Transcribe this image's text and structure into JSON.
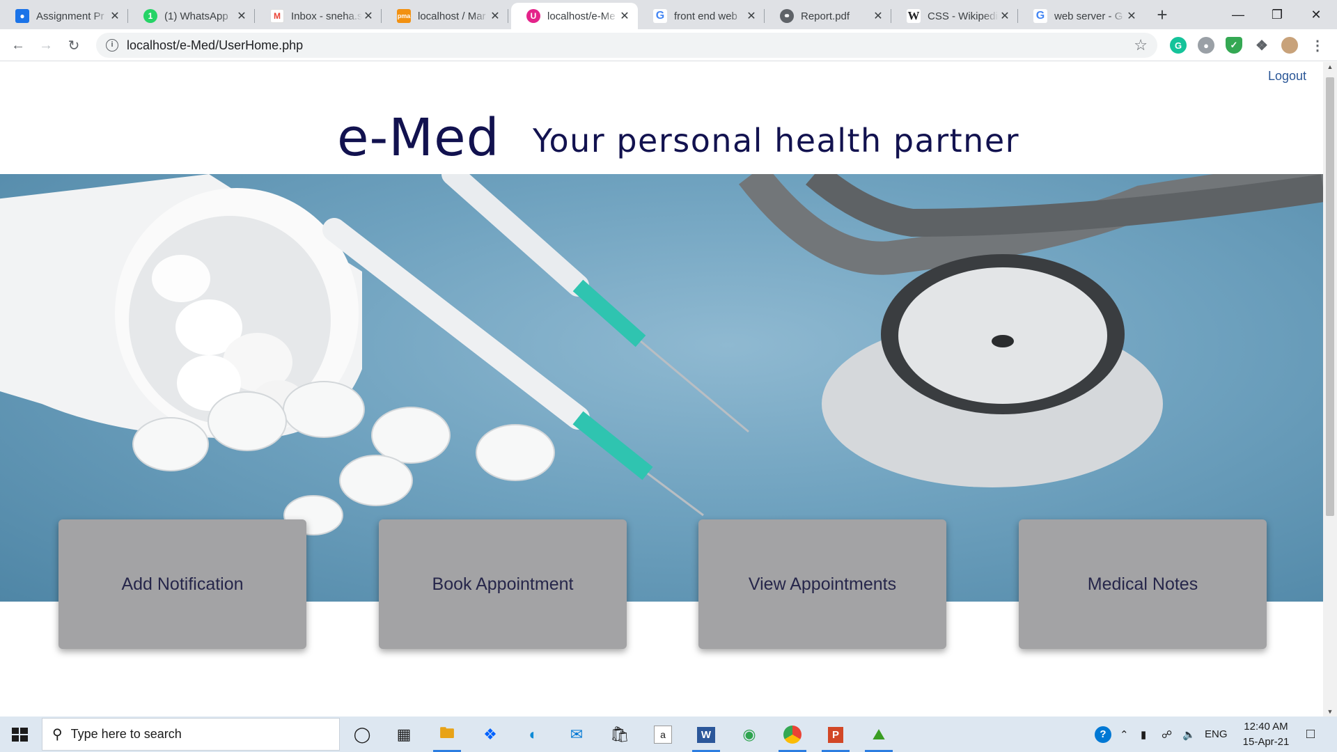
{
  "browser": {
    "tabs": [
      {
        "title": "Assignment Pr",
        "favicon": "classroom-icon",
        "color": "#1a73e8",
        "active": false
      },
      {
        "title": "(1) WhatsApp",
        "favicon": "whatsapp-icon",
        "color": "#25d366",
        "active": false
      },
      {
        "title": "Inbox - sneha.s",
        "favicon": "gmail-icon",
        "color": "#ea4335",
        "active": false
      },
      {
        "title": "localhost / Mar",
        "favicon": "phpmyadmin-icon",
        "color": "#f29111",
        "active": false
      },
      {
        "title": "localhost/e-Me",
        "favicon": "emed-site-icon",
        "color": "#e4238a",
        "active": true
      },
      {
        "title": "front end web",
        "favicon": "google-icon",
        "color": "#4285f4",
        "active": false
      },
      {
        "title": "Report.pdf",
        "favicon": "globe-icon",
        "color": "#5f6368",
        "active": false
      },
      {
        "title": "CSS - Wikipedi",
        "favicon": "wikipedia-icon",
        "color": "#202124",
        "active": false
      },
      {
        "title": "web server - G",
        "favicon": "google-icon",
        "color": "#4285f4",
        "active": false
      }
    ],
    "new_tab_label": "+",
    "url": "localhost/e-Med/UserHome.php"
  },
  "page": {
    "logout_label": "Logout",
    "brand": "e-Med",
    "tagline": "Your personal health partner",
    "hero_image": "syringes-pills-stethoscope-photo",
    "cards": [
      {
        "label": "Add Notification"
      },
      {
        "label": "Book Appointment"
      },
      {
        "label": "View Appointments"
      },
      {
        "label": "Medical Notes"
      }
    ]
  },
  "taskbar": {
    "search_placeholder": "Type here to search",
    "apps": [
      "cortana-icon",
      "task-view-icon",
      "file-explorer-icon",
      "dropbox-icon",
      "edge-icon",
      "mail-icon",
      "store-icon",
      "amazon-icon",
      "word-icon",
      "maps-icon",
      "chrome-icon",
      "powerpoint-icon",
      "photos-icon"
    ],
    "language": "ENG",
    "time": "12:40 AM",
    "date": "15-Apr-21"
  },
  "colors": {
    "brand_navy": "#12124f",
    "card_gray": "#a3a3a5",
    "logout_link": "#2b5797"
  }
}
